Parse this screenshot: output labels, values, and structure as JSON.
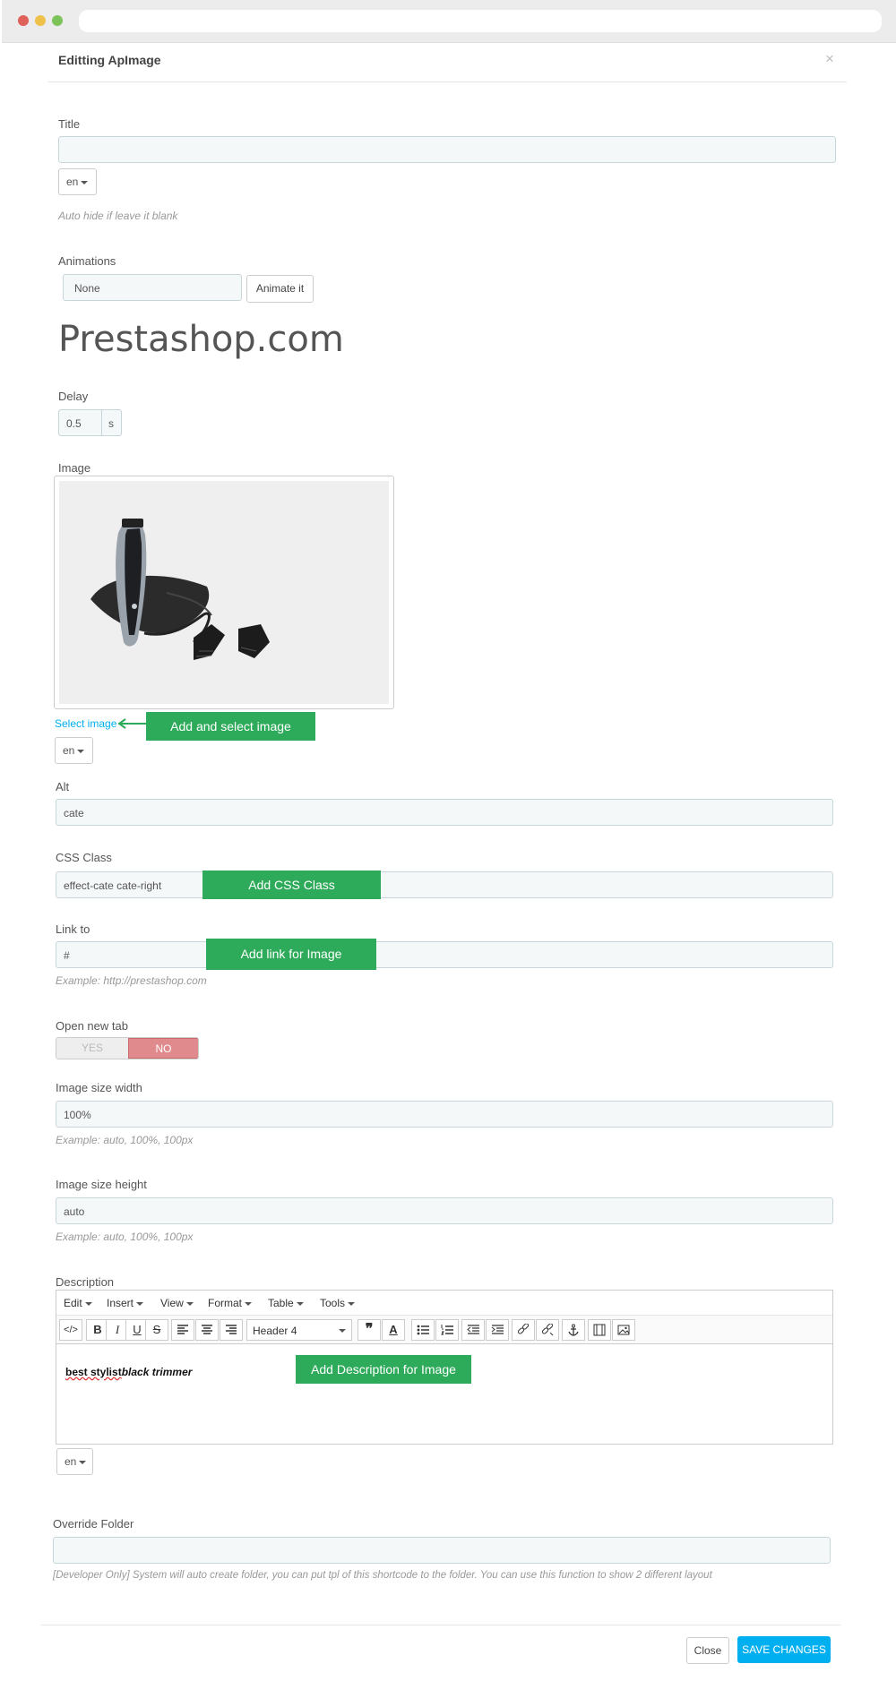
{
  "modal": {
    "title": "Editting ApImage",
    "close_icon": "×"
  },
  "title_field": {
    "label": "Title",
    "value": "",
    "lang": "en",
    "help": "Auto hide if leave it blank"
  },
  "animations": {
    "label": "Animations",
    "value": "None",
    "button": "Animate it",
    "preview_text": "Prestashop.com"
  },
  "delay": {
    "label": "Delay",
    "value": "0.5",
    "unit": "s"
  },
  "image": {
    "label": "Image",
    "select_link": "Select image",
    "lang": "en"
  },
  "alt": {
    "label": "Alt",
    "value": "cate"
  },
  "css_class": {
    "label": "CSS Class",
    "value": "effect-cate cate-right"
  },
  "link_to": {
    "label": "Link to",
    "value": "#",
    "help": "Example: http://prestashop.com"
  },
  "open_new_tab": {
    "label": "Open new tab",
    "yes": "YES",
    "no": "NO",
    "selected": "NO"
  },
  "image_width": {
    "label": "Image size width",
    "value": "100%",
    "help": "Example: auto, 100%, 100px"
  },
  "image_height": {
    "label": "Image size height",
    "value": "auto",
    "help": "Example: auto, 100%, 100px"
  },
  "description": {
    "label": "Description",
    "menus": [
      "Edit",
      "Insert",
      "View",
      "Format",
      "Table",
      "Tools"
    ],
    "format_select": "Header 4",
    "content_part1": "best stylist",
    "content_part2": "black",
    "content_part3": " trimmer",
    "lang": "en"
  },
  "override_folder": {
    "label": "Override Folder",
    "value": "",
    "help": "[Developer Only] System will auto create folder, you can put tpl of this shortcode to the folder. You can use this function to show 2 different layout"
  },
  "annotations": {
    "select_image": "Add and select image",
    "css_class": "Add CSS Class",
    "link": "Add link for Image",
    "description": "Add Description for Image"
  },
  "footer": {
    "close": "Close",
    "save": "SAVE CHANGES"
  },
  "colors": {
    "annotation_green": "#2eab5a",
    "primary_blue": "#00aff0",
    "no_red": "#e08a8e",
    "link_blue": "#00aff0"
  }
}
